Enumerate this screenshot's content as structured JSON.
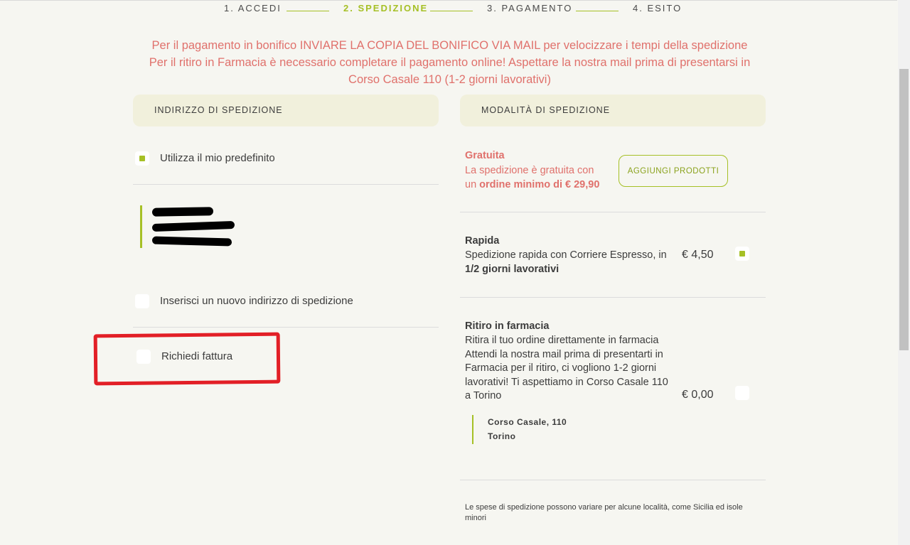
{
  "steps": [
    {
      "label": "1. ACCEDI"
    },
    {
      "label": "2. SPEDIZIONE"
    },
    {
      "label": "3. PAGAMENTO"
    },
    {
      "label": "4. ESITO"
    }
  ],
  "notice": {
    "line1": "Per il pagamento in bonifico INVIARE LA COPIA DEL BONIFICO VIA MAIL per velocizzare i tempi della spedizione",
    "line2": "Per il ritiro in Farmacia è necessario completare il pagamento online! Aspettare la nostra mail prima di presentarsi in",
    "line3": "Corso Casale 110 (1-2 giorni lavorativi)"
  },
  "address": {
    "header": "INDIRIZZO DI SPEDIZIONE",
    "use_default": "Utilizza il mio predefinito",
    "new_address": "Inserisci un nuovo indirizzo di spedizione",
    "invoice": "Richiedi fattura"
  },
  "shipping": {
    "header": "MODALITÀ DI SPEDIZIONE",
    "free": {
      "title": "Gratuita",
      "desc_pre": "La spedizione è gratuita con un ",
      "desc_bold": "ordine minimo di € 29,90",
      "button": "AGGIUNGI PRODOTTI"
    },
    "fast": {
      "title": "Rapida",
      "desc_pre": "Spedizione rapida con Corriere Espresso, in ",
      "desc_bold": "1/2 giorni lavorativi",
      "price": "€ 4,50"
    },
    "pickup": {
      "title": "Ritiro in farmacia",
      "desc": "Ritira il tuo ordine direttamente in farmacia Attendi la nostra mail prima di presentarti in Farmacia per il ritiro, ci vogliono 1-2 giorni lavorativi! Ti aspettiamo in Corso Casale 110 a Torino",
      "price": "€ 0,00",
      "store_street": "Corso Casale, 110",
      "store_city": "Torino"
    },
    "footnote": "Le spese di spedizione possono variare per alcune località, come Sicilia ed isole minori"
  },
  "colors": {
    "accent": "#a6c026",
    "notice": "#e0716c",
    "highlight_box": "#e21f26"
  }
}
